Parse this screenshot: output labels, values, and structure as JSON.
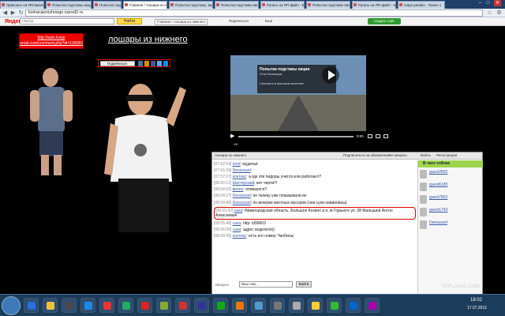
{
  "browser": {
    "tabs": [
      {
        "label": "Прикольн на ЯПлакаль"
      },
      {
        "label": "Попытка подставы акци"
      },
      {
        "label": "Попытка подставы, видео"
      },
      {
        "label": "Главная / лошара из ниж"
      },
      {
        "label": "Попытка подставы, видео"
      },
      {
        "label": "Попытка подставы вис"
      },
      {
        "label": "Ругань на ЯП файл - Видео"
      },
      {
        "label": "Попытка подставы вис"
      },
      {
        "label": "Ругань на ЯП файл - видео"
      },
      {
        "label": "maps.yandex - Поиск о"
      }
    ],
    "address": "losharaіznizhnego.narod2.ru",
    "window_controls": [
      "–",
      "□",
      "✕"
    ]
  },
  "yandex_bar": {
    "logo": "Яндекс",
    "search_placeholder": "народ",
    "find_label": "Найти",
    "items": [
      "Главная / лошара из нижнего",
      "Поделиться",
      "Ещё"
    ],
    "create_label": "создать сайт"
  },
  "page": {
    "red_link": "http://auto.livejo urnal.com/comment.php?id=136063",
    "title": "лошары из нижнего",
    "share_label": "Поделиться"
  },
  "video": {
    "title": "Попытка подставы акции",
    "channel": "Стас Белявцев",
    "watch_later": "Смотреть в высоком качестве",
    "time": "0:00",
    "vk_label": "VK"
  },
  "chat": {
    "top_title": "лошара из нижнего",
    "top_items": [
      "Подписаться на обновления",
      "Не мешать",
      "Войти",
      "Регистрация"
    ],
    "messages": [
      {
        "time": "[07:52:54]",
        "user": "nmrt",
        "text": "мудачьё"
      },
      {
        "time": "[07:56:39]",
        "user": "Denssssel",
        "text": ""
      },
      {
        "time": "[07:57:07]",
        "user": "контекс",
        "text": "а где эти пидоры учатся или работают?"
      },
      {
        "time": "[08:00:12]",
        "user": "Шаттерский",
        "text": "вот черти!!!"
      },
      {
        "time": "[08:04:02]",
        "user": "вееен",
        "text": "отмазался?"
      },
      {
        "time": "[08:04:27]",
        "user": "Denssssel",
        "text": "по телеку уже показывали их"
      },
      {
        "time": "[08:04:40]",
        "user": "Denssssel",
        "text": "по вечерке местных мусоров (они сухи невиновны)"
      },
      {
        "time": "[08:05:42]",
        "user": "саха",
        "text": "Нижегородская область, Большое Козино р.п. м Горького ул. 28 Малышев Антон Алексеевич",
        "highlight": true
      },
      {
        "time": "[08:05:48]",
        "user": "саха",
        "text": "http: id99603"
      },
      {
        "time": "[08:06:00]",
        "user": "саха",
        "text": "адрес водителя))"
      },
      {
        "time": "[08:09:45]",
        "user": "контекс",
        "text": "есть его номер ?мобилы"
      }
    ],
    "side_title": "В чате сейчас",
    "guests": [
      "guest2802",
      "guest6185",
      "guest7852",
      "guest1743",
      "Denssssel"
    ],
    "input_label": "Введите",
    "input_placeholder": "Ваш Ник...",
    "send_label": "Войти"
  },
  "taskbar": {
    "time": "18:02",
    "date": "17.07.2012",
    "watermark": "YAPLAKAL.COM",
    "icon_colors": [
      "#2b6fd6",
      "#f0c23b",
      "#4a4a4a",
      "#1e88e5",
      "#e33",
      "#2a6",
      "#d22",
      "#8a3",
      "#c33",
      "#339",
      "#1a1",
      "#e70",
      "#59c",
      "#777",
      "#aaa",
      "#fc3",
      "#3b3",
      "#06c",
      "#a0a"
    ]
  }
}
